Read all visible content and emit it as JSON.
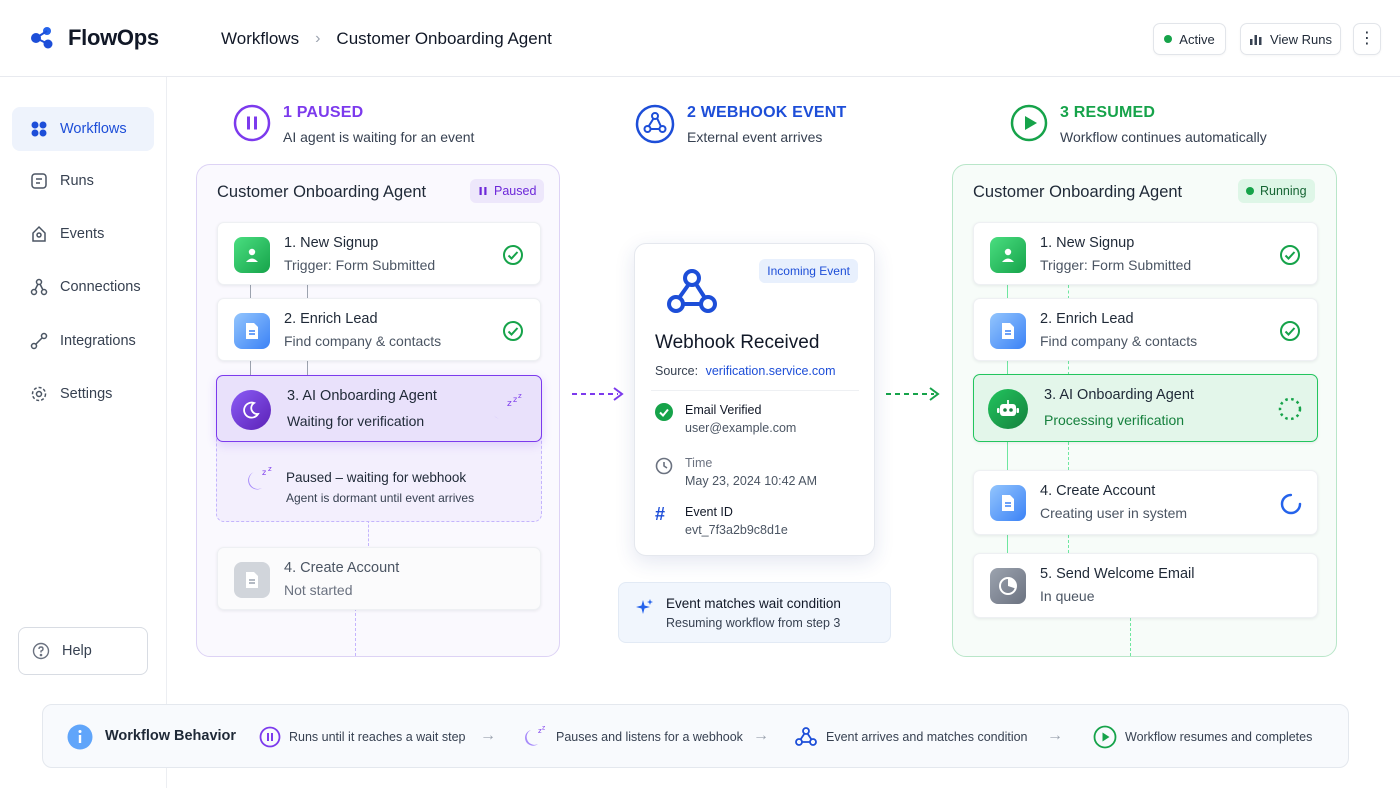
{
  "app": {
    "name": "FlowOps"
  },
  "breadcrumb": {
    "root": "Workflows",
    "current": "Customer Onboarding Agent"
  },
  "header_actions": {
    "status": "Active",
    "view_runs": "View Runs"
  },
  "sidebar": {
    "items": [
      {
        "label": "Workflows",
        "icon": "workflows-icon",
        "active": true
      },
      {
        "label": "Runs",
        "icon": "runs-icon"
      },
      {
        "label": "Events",
        "icon": "events-icon"
      },
      {
        "label": "Connections",
        "icon": "connections-icon"
      },
      {
        "label": "Integrations",
        "icon": "integrations-icon"
      },
      {
        "label": "Settings",
        "icon": "gear-icon"
      }
    ],
    "help": "Help"
  },
  "stages": [
    {
      "title": "1 PAUSED",
      "subtitle": "AI agent is waiting for an event",
      "color": "#7c3aed"
    },
    {
      "title": "2 WEBHOOK EVENT",
      "subtitle": "External event arrives",
      "color": "#1d4ed8"
    },
    {
      "title": "3 RESUMED",
      "subtitle": "Workflow continues automatically",
      "color": "#16a34a"
    }
  ],
  "paused_panel": {
    "title": "Customer Onboarding Agent",
    "badge": "Paused",
    "steps": [
      {
        "title": "1. New Signup",
        "sub": "Trigger: Form Submitted"
      },
      {
        "title": "2. Enrich Lead",
        "sub": "Find company & contacts"
      },
      {
        "title": "3. AI Onboarding Agent",
        "sub": "Waiting for verification"
      }
    ],
    "wait_note": {
      "title": "Paused – waiting for webhook",
      "sub": "Agent is dormant until event arrives"
    },
    "next_step": {
      "title": "4. Create Account",
      "sub": "Not started"
    }
  },
  "event": {
    "tag": "Incoming Event",
    "title": "Webhook Received",
    "source_label": "Source:",
    "source_value": "verification.service.com",
    "rows": [
      {
        "label": "Email Verified",
        "value": "user@example.com"
      },
      {
        "label": "Time",
        "value": "May 23, 2024  10:42 AM"
      },
      {
        "label": "Event ID",
        "value": "evt_7f3a2b9c8d1e"
      }
    ],
    "match": {
      "title": "Event matches wait condition",
      "sub": "Resuming workflow from step 3"
    }
  },
  "resumed_panel": {
    "title": "Customer Onboarding Agent",
    "badge": "Running",
    "steps": [
      {
        "title": "1. New Signup",
        "sub": "Trigger: Form Submitted"
      },
      {
        "title": "2. Enrich Lead",
        "sub": "Find company & contacts"
      },
      {
        "title": "3. AI Onboarding Agent",
        "sub": "Processing verification"
      },
      {
        "title": "4. Create Account",
        "sub": "Creating user in system"
      },
      {
        "title": "5. Send Welcome Email",
        "sub": "In queue"
      }
    ]
  },
  "footer": {
    "title": "Workflow Behavior",
    "items": [
      "Runs until it reaches a wait step",
      "Pauses and listens for a webhook",
      "Event arrives and matches condition",
      "Workflow resumes and completes"
    ]
  },
  "colors": {
    "purple": "#7c3aed",
    "blue": "#1d4ed8",
    "green": "#16a34a"
  }
}
